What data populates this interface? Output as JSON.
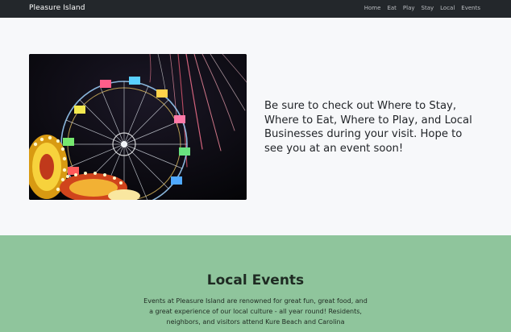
{
  "navbar": {
    "brand": "Pleasure Island",
    "links": [
      "Home",
      "Eat",
      "Play",
      "Stay",
      "Local",
      "Events"
    ]
  },
  "hero": {
    "text": "Be sure to check out Where to Stay, Where to Eat, Where to Play, and Local Businesses during your visit. Hope to see you at an event soon!"
  },
  "events": {
    "title": "Local Events",
    "body": "Events at Pleasure Island are renowned for great fun, great food, and a great experience of our local culture - all year round! Residents, neighbors, and visitors attend Kure Beach and Carolina"
  },
  "colors": {
    "navbar": "#23272b",
    "page_bg": "#f7f8fa",
    "events_bg": "#8fc59c"
  }
}
